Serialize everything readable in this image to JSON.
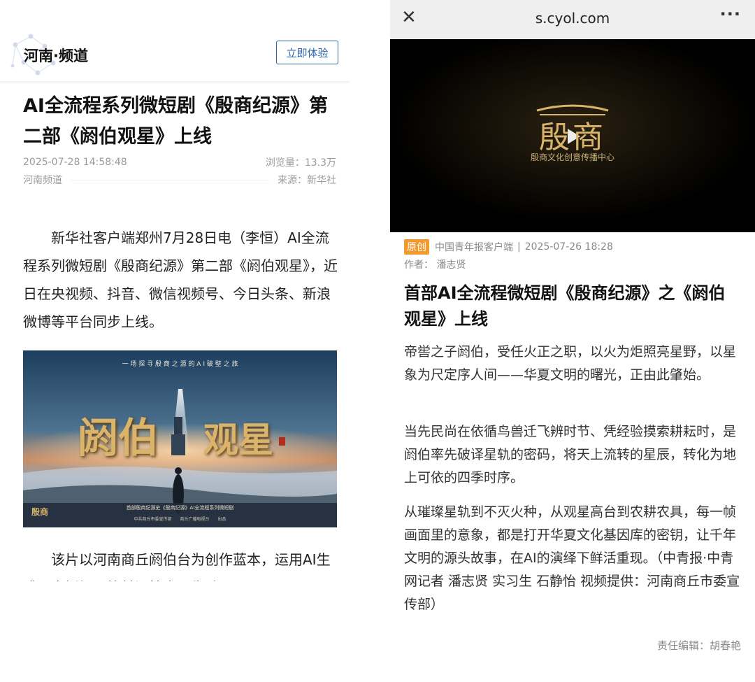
{
  "left": {
    "brand": "河南·频道",
    "try_button": "立即体验",
    "title": "AI全流程系列微短剧《殷商纪源》第二部《阏伯观星》上线",
    "datetime": "2025-07-28 14:58:48",
    "views": "浏览量：13.3万",
    "channel": "河南频道",
    "source": "来源：新华社",
    "paragraph1": "新华社客户端郑州7月28日电（李恒）AI全流程系列微短剧《殷商纪源》第二部《阏伯观星》，近日在央视频、抖音、微信视频号、今日头条、新浪微博等平台同步上线。",
    "poster": {
      "tagline": "一 场 探 寻 殷 商 之 源 的 A I 破 壁 之 旅",
      "title_left": "阏伯",
      "title_right": "观星",
      "footer_line": "首部殷商纪源史《殷商纪源》AI全流程系列微短剧",
      "credits": "中共商丘市委宣传部　　商丘广播电视台　　出品",
      "corner_logo": "殷商"
    },
    "paragraph2": "该片以河南商丘阏伯台为创作蓝本，运用AI生成、虚拟场景等前沿技术，生动再现"
  },
  "right": {
    "url": "s.cyol.com",
    "close_icon": "close-icon",
    "more_icon": "more-icon",
    "video": {
      "logo_text": "殷商",
      "subtitle": "殷商文化创意传播中心"
    },
    "badge": "原创",
    "outlet": "中国青年报客户端",
    "datetime": "2025-07-26 18:28",
    "author": "作者：  潘志贤",
    "title": "首部AI全流程微短剧《殷商纪源》之《阏伯观星》上线",
    "paragraphs": [
      "帝喾之子阏伯，受任火正之职，以火为炬照亮星野，以星象为尺定序人间——华夏文明的曙光，正由此肇始。",
      "当先民尚在依循鸟兽迁飞辨时节、凭经验摸索耕耘时，是阏伯率先破译星轨的密码，将天上流转的星辰，转化为地上可依的四季时序。",
      "从璀璨星轨到不灭火种，从观星高台到农耕农具，每一帧画面里的意象，都是打开华夏文化基因库的密钥，让千年文明的源头故事，在AI的演绎下鲜活重现。（中青报·中青网记者 潘志贤 实习生 石静怡 视频提供：河南商丘市委宣传部）"
    ],
    "editor": "责任编辑：胡春艳"
  },
  "colors": {
    "accent_blue": "#2e63a8",
    "badge_orange": "#f39a2e",
    "gold": "#d9b46a"
  }
}
